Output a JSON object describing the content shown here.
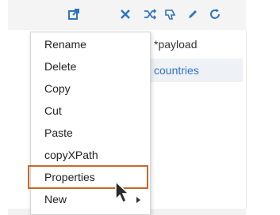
{
  "toolbar": {
    "icons": [
      "open-external-icon",
      "close-icon",
      "shuffle-icon",
      "thumb-down-icon",
      "edit-icon",
      "refresh-icon"
    ],
    "accent_color": "#2f74c0"
  },
  "tree": {
    "items": [
      {
        "label": "*payload"
      },
      {
        "label": "countries"
      }
    ]
  },
  "context_menu": {
    "items": [
      {
        "label": "Rename"
      },
      {
        "label": "Delete"
      },
      {
        "label": "Copy"
      },
      {
        "label": "Cut"
      },
      {
        "label": "Paste"
      },
      {
        "label": "copyXPath"
      },
      {
        "label": "Properties"
      },
      {
        "label": "New"
      }
    ],
    "highlight_color": "#c56a2a"
  }
}
